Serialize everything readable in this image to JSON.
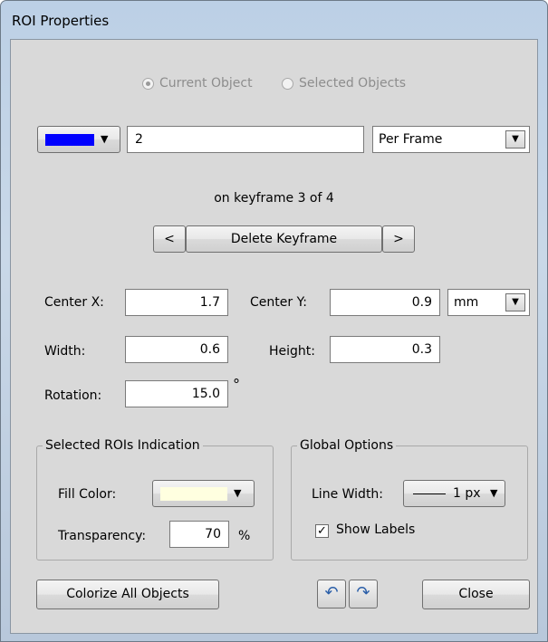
{
  "window": {
    "title": "ROI Properties"
  },
  "scope": {
    "current_object": {
      "label": "Current Object",
      "selected": true
    },
    "selected_objects": {
      "label": "Selected Objects",
      "selected": false
    }
  },
  "object": {
    "color": "#0000ff",
    "name_value": "2",
    "frame_mode": "Per Frame"
  },
  "keyframe": {
    "status": "on keyframe 3 of 4",
    "prev_label": "<",
    "delete_label": "Delete Keyframe",
    "next_label": ">"
  },
  "geometry": {
    "center_x_label": "Center X:",
    "center_x_value": "1.7",
    "center_y_label": "Center Y:",
    "center_y_value": "0.9",
    "unit": "mm",
    "width_label": "Width:",
    "width_value": "0.6",
    "height_label": "Height:",
    "height_value": "0.3",
    "rotation_label": "Rotation:",
    "rotation_value": "15.0",
    "rotation_unit": "°"
  },
  "selected_indication": {
    "title": "Selected ROIs Indication",
    "fill_color_label": "Fill Color:",
    "fill_color": "#ffffe0",
    "transparency_label": "Transparency:",
    "transparency_value": "70",
    "transparency_unit": "%"
  },
  "global_options": {
    "title": "Global Options",
    "line_width_label": "Line Width:",
    "line_width_value": "1 px",
    "show_labels_label": "Show Labels",
    "show_labels_checked": true
  },
  "footer": {
    "colorize_label": "Colorize All Objects",
    "undo_icon": "undo-icon",
    "redo_icon": "redo-icon",
    "close_label": "Close"
  }
}
